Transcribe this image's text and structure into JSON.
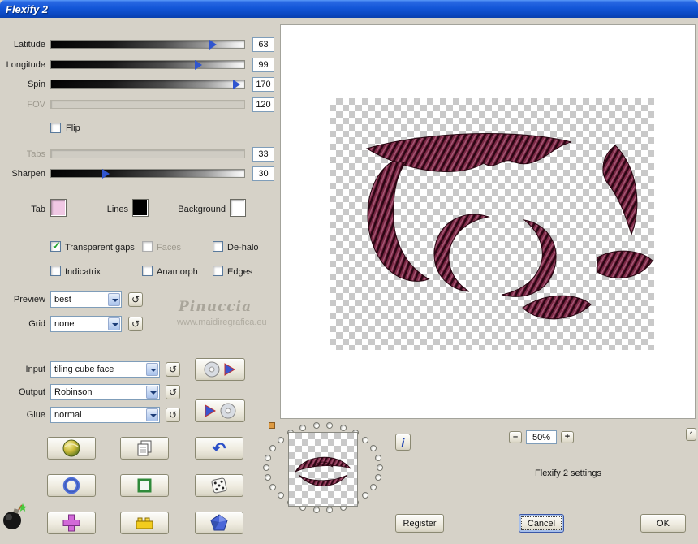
{
  "titlebar": {
    "title": "Flexify 2"
  },
  "sliders": {
    "latitude": {
      "label": "Latitude",
      "value": "63"
    },
    "longitude": {
      "label": "Longitude",
      "value": "99"
    },
    "spin": {
      "label": "Spin",
      "value": "170"
    },
    "fov": {
      "label": "FOV",
      "value": "120"
    },
    "tabs": {
      "label": "Tabs",
      "value": "33"
    },
    "sharpen": {
      "label": "Sharpen",
      "value": "30"
    }
  },
  "checkboxes": {
    "flip": {
      "label": "Flip",
      "checked": false
    },
    "transparent_gaps": {
      "label": "Transparent gaps",
      "checked": true
    },
    "faces": {
      "label": "Faces",
      "checked": false,
      "enabled": false
    },
    "de_halo": {
      "label": "De-halo",
      "checked": false
    },
    "indicatrix": {
      "label": "Indicatrix",
      "checked": false
    },
    "anamorph": {
      "label": "Anamorph",
      "checked": false
    },
    "edges": {
      "label": "Edges",
      "checked": false
    }
  },
  "swatches": {
    "tab": {
      "label": "Tab",
      "color": "#f0c8e4"
    },
    "lines": {
      "label": "Lines",
      "color": "#000000"
    },
    "background": {
      "label": "Background",
      "color": "#ffffff"
    }
  },
  "combos": {
    "preview": {
      "label": "Preview",
      "value": "best"
    },
    "grid": {
      "label": "Grid",
      "value": "none"
    },
    "input": {
      "label": "Input",
      "value": "tiling cube face"
    },
    "output": {
      "label": "Output",
      "value": "Robinson"
    },
    "glue": {
      "label": "Glue",
      "value": "normal"
    }
  },
  "glyphs": {
    "cycle": "↺",
    "undo": "↶",
    "info": "i",
    "caret": "^"
  },
  "watermark": {
    "name": "Pinuccia",
    "site": "www.maidiregrafica.eu"
  },
  "zoom": {
    "minus": "–",
    "level": "50%",
    "plus": "+"
  },
  "status_text": "Flexify 2 settings",
  "actions": {
    "register": "Register",
    "cancel": "Cancel",
    "ok": "OK"
  },
  "image_colors": {
    "base": "#7d2946",
    "dark_rib": "#2c0614",
    "light_rib": "#aa5f7d"
  }
}
